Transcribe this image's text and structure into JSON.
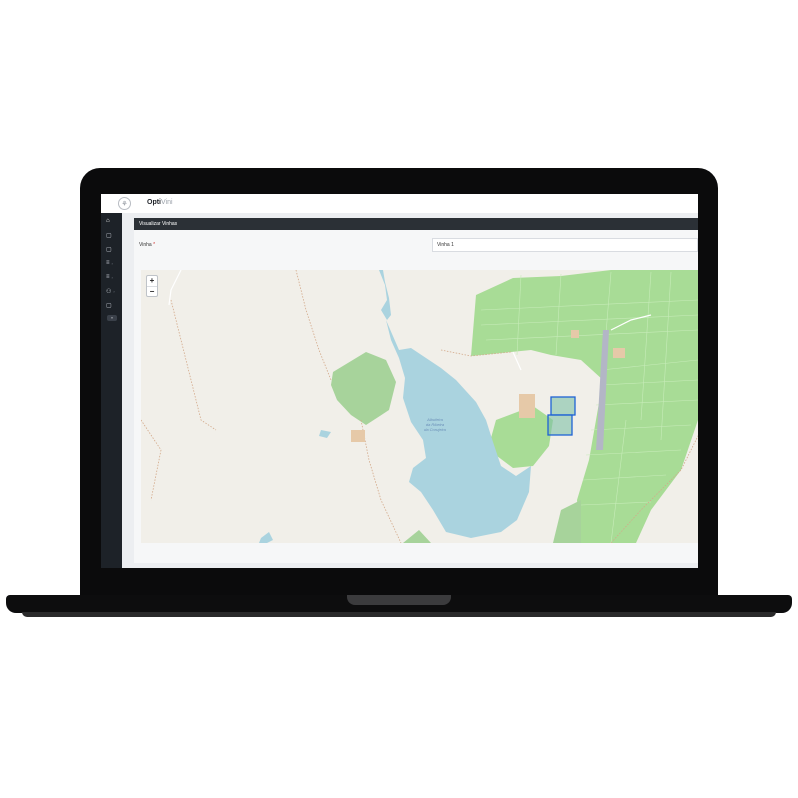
{
  "app": {
    "brand_strong": "Opti",
    "brand_light": "Vini"
  },
  "sidebar": {
    "items": [
      {
        "icon": "home-icon",
        "glyph": "⌂"
      },
      {
        "icon": "page-icon",
        "glyph": "▢"
      },
      {
        "icon": "page-icon",
        "glyph": "▢"
      },
      {
        "icon": "list-icon",
        "glyph": "≡",
        "chevron": "›"
      },
      {
        "icon": "list-icon",
        "glyph": "≡",
        "chevron": "›"
      },
      {
        "icon": "users-icon",
        "glyph": "⚇",
        "chevron": "›"
      },
      {
        "icon": "page-icon",
        "glyph": "▢"
      }
    ],
    "collapse_glyph": "«"
  },
  "panel": {
    "title": "Visualizar Vinhas"
  },
  "form": {
    "label": "Vinha",
    "required_mark": "*",
    "selected": "Vinha 1"
  },
  "map": {
    "zoom_in": "+",
    "zoom_out": "−",
    "water_label_lines": [
      "Albufeira",
      "da Ribeira",
      "da Corujeira"
    ],
    "colors": {
      "land": "#f1efe9",
      "vineyard": "#a8dc96",
      "water": "#aad3df",
      "forest": "#a7d39b",
      "parcel_stroke": "#1f62d6",
      "road": "#b3b6c6"
    }
  }
}
